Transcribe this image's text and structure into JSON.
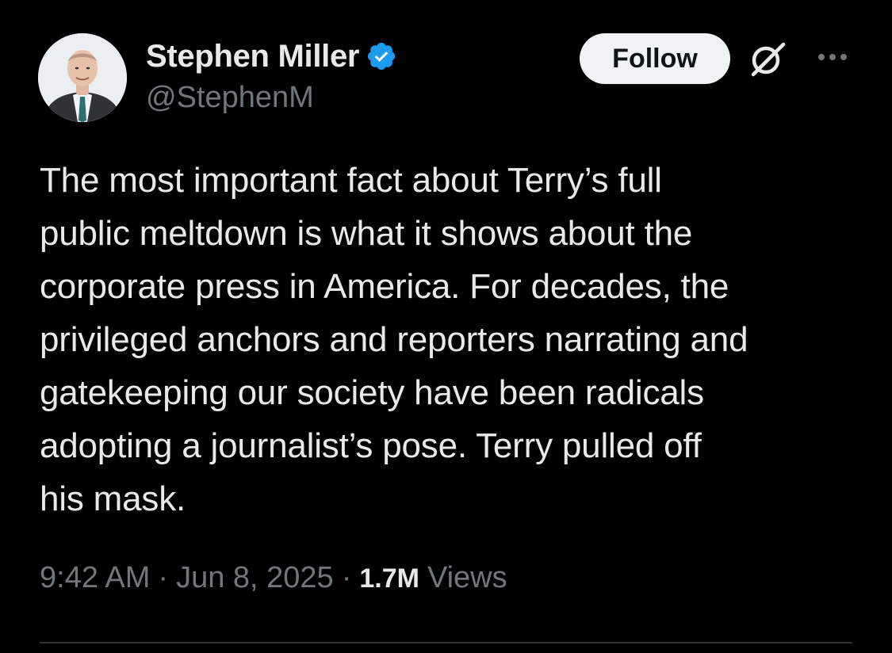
{
  "author": {
    "display_name": "Stephen Miller",
    "handle": "@StephenM",
    "verified": true,
    "avatar": "profile-photo"
  },
  "actions": {
    "follow_label": "Follow",
    "grok_icon": "grok-icon",
    "more_icon": "more-options-icon"
  },
  "tweet": {
    "text": "The most important fact about Terry’s full\npublic meltdown is what it shows about the\ncorporate press in America. For decades, the\nprivileged anchors and reporters narrating and\ngatekeeping our society have been radicals\nadopting a journalist’s pose. Terry pulled off\nhis mask."
  },
  "meta": {
    "time": "9:42 AM",
    "separator": "·",
    "date": "Jun 8, 2025",
    "views_count": "1.7M",
    "views_label": "Views"
  },
  "colors": {
    "background": "#000000",
    "text_primary": "#e7e9ea",
    "text_secondary": "#71767b",
    "verified_blue": "#1d9bf0",
    "follow_button_bg": "#eff3f4",
    "divider": "#2f3336"
  }
}
